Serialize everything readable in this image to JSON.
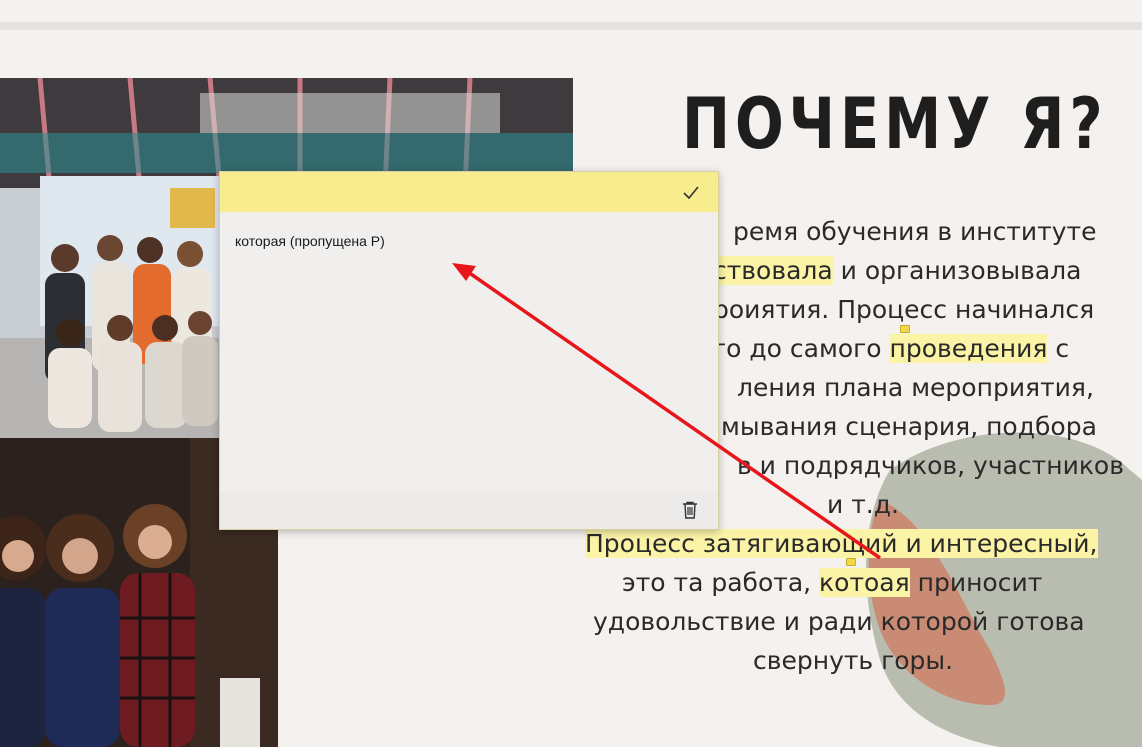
{
  "heading": "ПОЧЕМУ Я?",
  "body": {
    "lines": [
      [
        "ремя обучения в институте"
      ],
      [
        "ствовала",
        " и организовывала"
      ],
      [
        "роиятия. Процесс начинался"
      ],
      [
        "го до самого ",
        "проведения",
        " с"
      ],
      [
        "ления плана мероприятия,"
      ],
      [
        "мывания сценария, подбора"
      ],
      [
        "в и подрядчиков, участников"
      ],
      [
        "и т.д."
      ],
      [
        "Процесс затягивающий и интересный,"
      ],
      [
        "это та работа, ",
        "котоая",
        " приносит"
      ],
      [
        "удовольствие и ради которой готова"
      ],
      [
        "свернуть горы."
      ]
    ]
  },
  "note": {
    "text": "которая (пропущена Р)",
    "confirm_icon": "checkmark-icon",
    "delete_icon": "trash-icon"
  },
  "colors": {
    "highlight": "#fbf3a6",
    "note_header": "#f7ec8e",
    "arrow": "#e8161a",
    "blob_green": "#b9bdb0",
    "blob_brown": "#c98b73"
  }
}
